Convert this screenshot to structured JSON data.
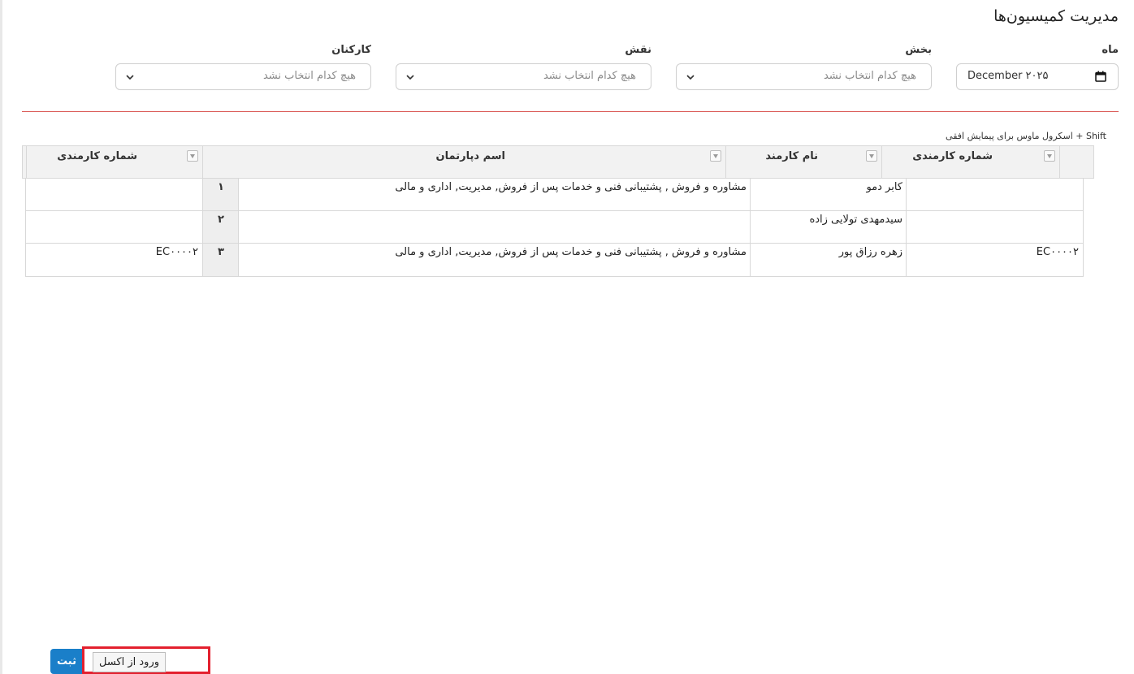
{
  "page": {
    "title": "مدیریت کمیسیون‌ها"
  },
  "filters": {
    "month": {
      "label": "ماه",
      "value": "December ۲۰۲۵",
      "icon": "calendar-icon"
    },
    "section": {
      "label": "بخش",
      "placeholder": "هیچ کدام انتخاب نشد",
      "icon": "chevron-down-icon"
    },
    "role": {
      "label": "نقش",
      "placeholder": "هیچ کدام انتخاب نشد",
      "icon": "chevron-down-icon"
    },
    "staff": {
      "label": "کارکنان",
      "placeholder": "هیچ کدام انتخاب نشد",
      "icon": "chevron-down-icon"
    }
  },
  "hint": "Shift + اسکرول ماوس برای پیمایش افقی",
  "table": {
    "columns": [
      "شماره کارمندی",
      "نام کارمند",
      "اسم دپارتمان",
      "شماره کارمندی"
    ],
    "rows": [
      {
        "emp_no": "",
        "name": "کابر دمو",
        "department": "مشاوره و فروش , پشتیبانی فنی و خدمات پس از فروش, مدیریت, اداری و مالی",
        "index": "۱",
        "emp_no_2": ""
      },
      {
        "emp_no": "",
        "name": "سیدمهدی تولایی زاده",
        "department": "",
        "index": "۲",
        "emp_no_2": ""
      },
      {
        "emp_no": "EC۰۰۰۰۲",
        "name": "زهره رزاق پور",
        "department": "مشاوره و فروش , پشتیبانی فنی و خدمات پس از فروش, مدیریت, اداری و مالی",
        "index": "۳",
        "emp_no_2": "EC۰۰۰۰۲"
      }
    ]
  },
  "actions": {
    "submit_label": "ثبت",
    "excel_label": "ورود از اکسل"
  },
  "colors": {
    "accent": "#1a7fc9",
    "divider": "#d9534f",
    "highlight": "#e3202e"
  }
}
